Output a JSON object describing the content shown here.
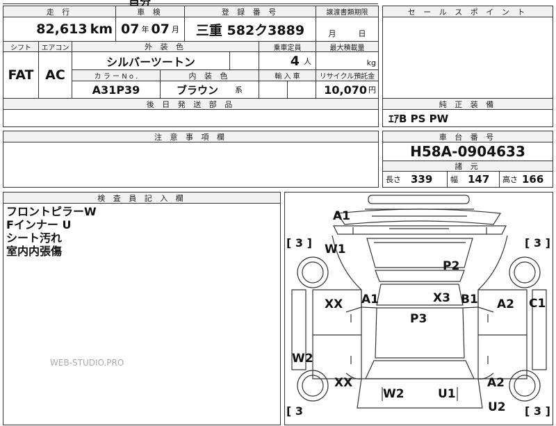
{
  "top_partial": {
    "text": "自分"
  },
  "sheet": {
    "mileage_header": "走 行",
    "mileage_value": "82,613",
    "mileage_unit": "km",
    "inspection_header": "車 検",
    "inspection_year": "07",
    "inspection_year_unit": "年",
    "inspection_month": "07",
    "inspection_month_unit": "月",
    "reg_header": "登 録 番 号",
    "reg_value": "三重 582ク3889",
    "transfer_header": "譲渡書類期限",
    "transfer_month_unit": "月",
    "transfer_day_unit": "日",
    "shift_header": "シフト",
    "shift_value": "FAT",
    "ac_header": "エアコン",
    "ac_value": "AC",
    "exterior_header": "外 装 色",
    "exterior_value": "シルバーツートン",
    "capacity_header": "乗車定員",
    "capacity_value": "4",
    "capacity_unit": "人",
    "maxload_header": "最大積載量",
    "maxload_unit": "kg",
    "color_no_header": "カ ラ ー N o .",
    "color_no_value": "A31P39",
    "interior_header": "内 装 色",
    "interior_value": "ブラウン",
    "interior_suffix": "系",
    "import_header": "輸 入 車",
    "recycle_header": "リサイクル預託金",
    "recycle_value": "10,070",
    "recycle_unit": "円",
    "later_parts_header": "後 日 発 送 部 品",
    "notes_header": "注 意 事 項 欄",
    "inspector_header": "検 査 員 記 入 欄",
    "inspector_notes": [
      "フロントピラーW",
      "Fインナー U",
      "シート汚れ",
      "室内内張傷"
    ]
  },
  "right_panel": {
    "sales_point_header": "セ ー ル ス ポ イ ン ト",
    "equipment_header": "純 正 装 備",
    "equipment_value": "ｴｱB PS PW",
    "chassis_header": "車 台 番 号",
    "chassis_value": "H58A-0904633",
    "spec_header": "諸 元",
    "length_label": "長さ",
    "length_value": "339",
    "width_label": "幅",
    "width_value": "147",
    "height_label": "高さ",
    "height_value": "166"
  },
  "diagram_marks": {
    "a1_top": "A1",
    "w1": "W1",
    "p2": "P2",
    "xx_left": "XX",
    "a1_mid": "A1",
    "x3": "X3",
    "b1": "B1",
    "a2_right": "A2",
    "c1": "C1",
    "p3": "P3",
    "w2_left": "W2",
    "xx_lower": "XX",
    "a2_lower": "A2",
    "w2_bottom": "W2",
    "u1": "U1",
    "u2": "U2",
    "bracket_tl": "[ 3 ]",
    "bracket_tr": "[ 3 ]",
    "bracket_bl": "[ 3",
    "bracket_br": "[ 3 ]"
  },
  "watermark": "WEB-STUDIO.PRO"
}
